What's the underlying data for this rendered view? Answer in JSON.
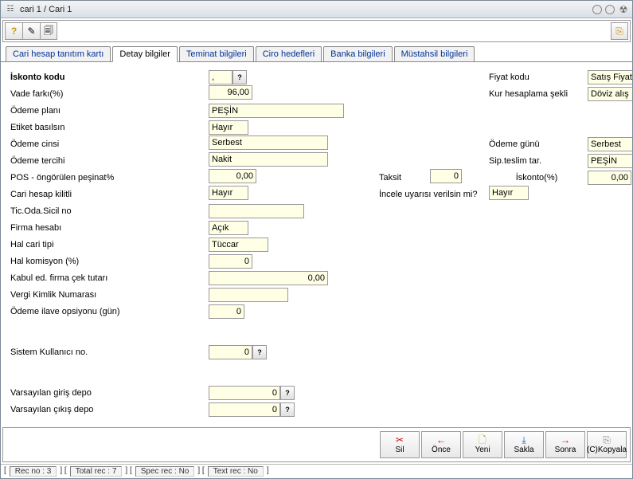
{
  "title": "cari 1 / Cari 1",
  "tabs": [
    "Cari hesap tanıtım kartı",
    "Detay bilgiler",
    "Teminat bilgileri",
    "Ciro hedefleri",
    "Banka bilgileri",
    "Müstahsil bilgileri"
  ],
  "active_tab": 1,
  "labels": {
    "iskonto_kodu": "İskonto kodu",
    "fiyat_kodu": "Fiyat kodu",
    "vade_farki": "Vade farkı(%)",
    "kur_hesaplama": "Kur hesaplama şekli",
    "odeme_plani": "Ödeme planı",
    "etiket_basilsin": "Etiket basılsın",
    "odeme_cinsi": "Ödeme cinsi",
    "odeme_gunu": "Ödeme günü",
    "odeme_tercihi": "Ödeme tercihi",
    "sip_teslim": "Sip.teslim tar.",
    "pos_pesinat": "POS - öngörülen peşinat%",
    "taksit": "Taksit",
    "iskonto_pct": "İskonto(%)",
    "cari_hesap_kilitli": "Cari hesap kilitli",
    "incele_uyari": "İncele uyarısı verilsin mi?",
    "tic_oda": "Tic.Oda.Sicil no",
    "firma_hesabi": "Firma hesabı",
    "hal_cari": "Hal cari tipi",
    "hal_komisyon": "Hal komisyon (%)",
    "kabul_cek": "Kabul ed. firma çek tutarı",
    "vergi_kimlik": "Vergi Kimlik Numarası",
    "odeme_ilave": "Ödeme ilave opsiyonu (gün)",
    "sistem_kullanici": "Sistem Kullanıcı no.",
    "varsayilan_giris": "Varsayılan giriş depo",
    "varsayilan_cikis": "Varsayılan çıkış depo"
  },
  "values": {
    "iskonto_kodu": ",",
    "fiyat_kodu": "Satış Fiyatı",
    "vade_farki": "96,00",
    "kur_hesaplama": "Döviz alış",
    "odeme_plani": "PEŞİN",
    "etiket_basilsin": "Hayır",
    "odeme_cinsi": "Serbest",
    "odeme_gunu": "Serbest",
    "odeme_tercihi": "Nakit",
    "sip_teslim": "PEŞİN",
    "pos_pesinat": "0,00",
    "taksit": "0",
    "iskonto_pct": "0,00",
    "cari_hesap_kilitli": "Hayır",
    "incele_uyari": "Hayır",
    "tic_oda": "",
    "firma_hesabi": "Açık",
    "hal_cari": "Tüccar",
    "hal_komisyon": "0",
    "kabul_cek": "0,00",
    "vergi_kimlik": "",
    "odeme_ilave": "0",
    "sistem_kullanici": "0",
    "varsayilan_giris": "0",
    "varsayilan_cikis": "0"
  },
  "lookup_glyph": "?",
  "actions": {
    "sil": "Sil",
    "once": "Önce",
    "yeni": "Yeni",
    "sakla": "Sakla",
    "sonra": "Sonra",
    "kopyala": "(C)Kopyala"
  },
  "status": {
    "rec_no": "Rec no : 3",
    "total_rec": "Total rec : 7",
    "spec_rec": "Spec rec : No",
    "text_rec": "Text rec : No"
  }
}
